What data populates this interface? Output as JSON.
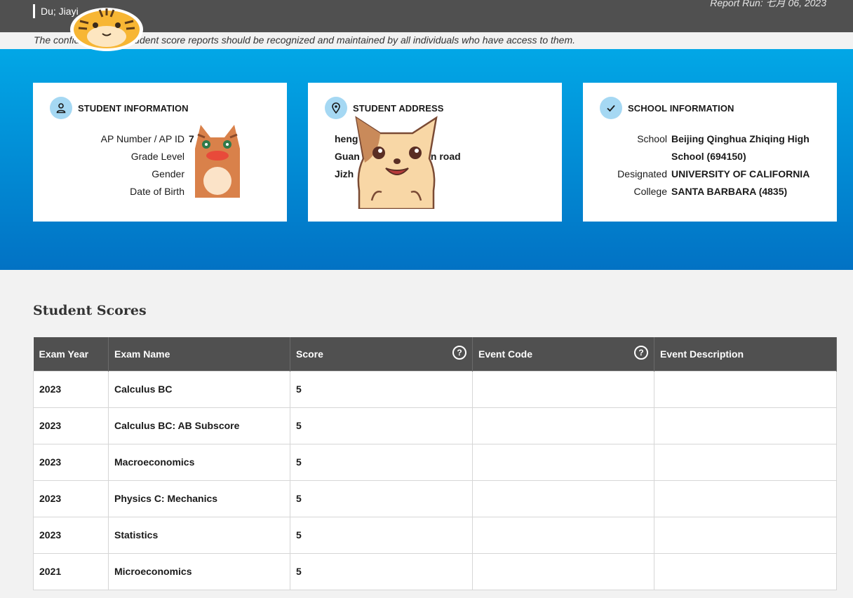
{
  "header": {
    "student_name": "Du; Jiayi",
    "report_run": "Report Run: 七月 06, 2023",
    "confidentiality": "The confidentiality of student score reports should be recognized and maintained by all individuals who have access to them."
  },
  "student_info": {
    "title": "STUDENT INFORMATION",
    "icon": "person-icon",
    "rows": [
      {
        "label": "AP Number / AP ID",
        "value": "7"
      },
      {
        "label": "Grade Level",
        "value": ""
      },
      {
        "label": "Gender",
        "value": ""
      },
      {
        "label": "Date of Birth",
        "value": ""
      }
    ]
  },
  "student_address": {
    "title": "STUDENT ADDRESS",
    "icon": "location-pin-icon",
    "lines": [
      "heng",
      "Guan                          n road",
      "Jizh"
    ]
  },
  "school_info": {
    "title": "SCHOOL INFORMATION",
    "icon": "checkmark-icon",
    "rows": [
      {
        "label": "School",
        "value": "Beijing Qinghua Zhiqing High"
      },
      {
        "label": "",
        "value": "School (694150)"
      },
      {
        "label": "Designated",
        "value": "UNIVERSITY OF CALIFORNIA"
      },
      {
        "label": "College",
        "value": "SANTA BARBARA (4835)"
      }
    ]
  },
  "scores": {
    "title": "Student Scores",
    "columns": [
      "Exam Year",
      "Exam Name",
      "Score",
      "Event Code",
      "Event Description"
    ],
    "help_glyph": "?",
    "rows": [
      {
        "year": "2023",
        "name": "Calculus BC",
        "score": "5",
        "code": "",
        "desc": ""
      },
      {
        "year": "2023",
        "name": "Calculus BC: AB Subscore",
        "score": "5",
        "code": "",
        "desc": ""
      },
      {
        "year": "2023",
        "name": "Macroeconomics",
        "score": "5",
        "code": "",
        "desc": ""
      },
      {
        "year": "2023",
        "name": "Physics C: Mechanics",
        "score": "5",
        "code": "",
        "desc": ""
      },
      {
        "year": "2023",
        "name": "Statistics",
        "score": "5",
        "code": "",
        "desc": ""
      },
      {
        "year": "2021",
        "name": "Microeconomics",
        "score": "5",
        "code": "",
        "desc": ""
      }
    ]
  },
  "colors": {
    "header_bg": "#505050",
    "banner_top": "#02a7e6",
    "banner_bottom": "#0272c4",
    "icon_circle": "#a5d8f3"
  }
}
